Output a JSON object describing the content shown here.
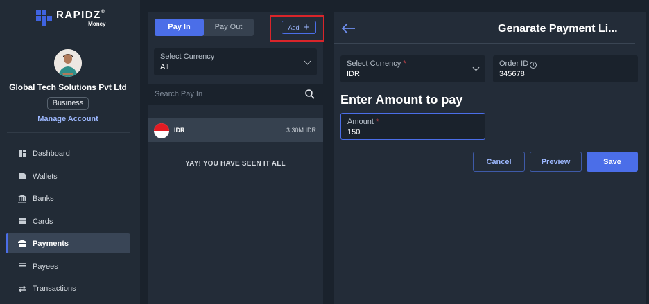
{
  "brand": {
    "name": "RAPIDZ",
    "mark": "®",
    "sub": "Money"
  },
  "profile": {
    "company": "Global Tech Solutions Pvt Ltd",
    "badge": "Business",
    "manage_link": "Manage Account"
  },
  "nav": [
    {
      "label": "Dashboard",
      "icon": "dashboard-icon",
      "active": false
    },
    {
      "label": "Wallets",
      "icon": "wallet-icon",
      "active": false
    },
    {
      "label": "Banks",
      "icon": "bank-icon",
      "active": false
    },
    {
      "label": "Cards",
      "icon": "card-icon",
      "active": false
    },
    {
      "label": "Payments",
      "icon": "payments-icon",
      "active": true
    },
    {
      "label": "Payees",
      "icon": "payees-icon",
      "active": false
    },
    {
      "label": "Transactions",
      "icon": "transactions-icon",
      "active": false
    }
  ],
  "middle": {
    "tabs": {
      "pay_in": "Pay In",
      "pay_out": "Pay Out",
      "active": "Pay In"
    },
    "add_button": "Add",
    "currency_select": {
      "label": "Select Currency",
      "value": "All"
    },
    "search": {
      "placeholder": "Search Pay In"
    },
    "list": [
      {
        "currency": "IDR",
        "amount": "3.30M IDR",
        "flag": "indonesia-flag-icon"
      }
    ],
    "end_message": "YAY! YOU HAVE SEEN IT ALL"
  },
  "form": {
    "title": "Genarate Payment Li...",
    "currency": {
      "label": "Select Currency",
      "required_mark": "*",
      "value": "IDR"
    },
    "order_id": {
      "label": "Order ID",
      "value": "345678",
      "info_icon": "i"
    },
    "section_title": "Enter Amount to pay",
    "amount": {
      "label": "Amount",
      "required_mark": "*",
      "value": "150"
    },
    "buttons": {
      "cancel": "Cancel",
      "preview": "Preview",
      "save": "Save"
    }
  },
  "colors": {
    "accent": "#4b6ee8",
    "highlight_box": "#d9252a",
    "required": "#e5484d",
    "background": "#1a222c",
    "panel": "#232c38"
  }
}
